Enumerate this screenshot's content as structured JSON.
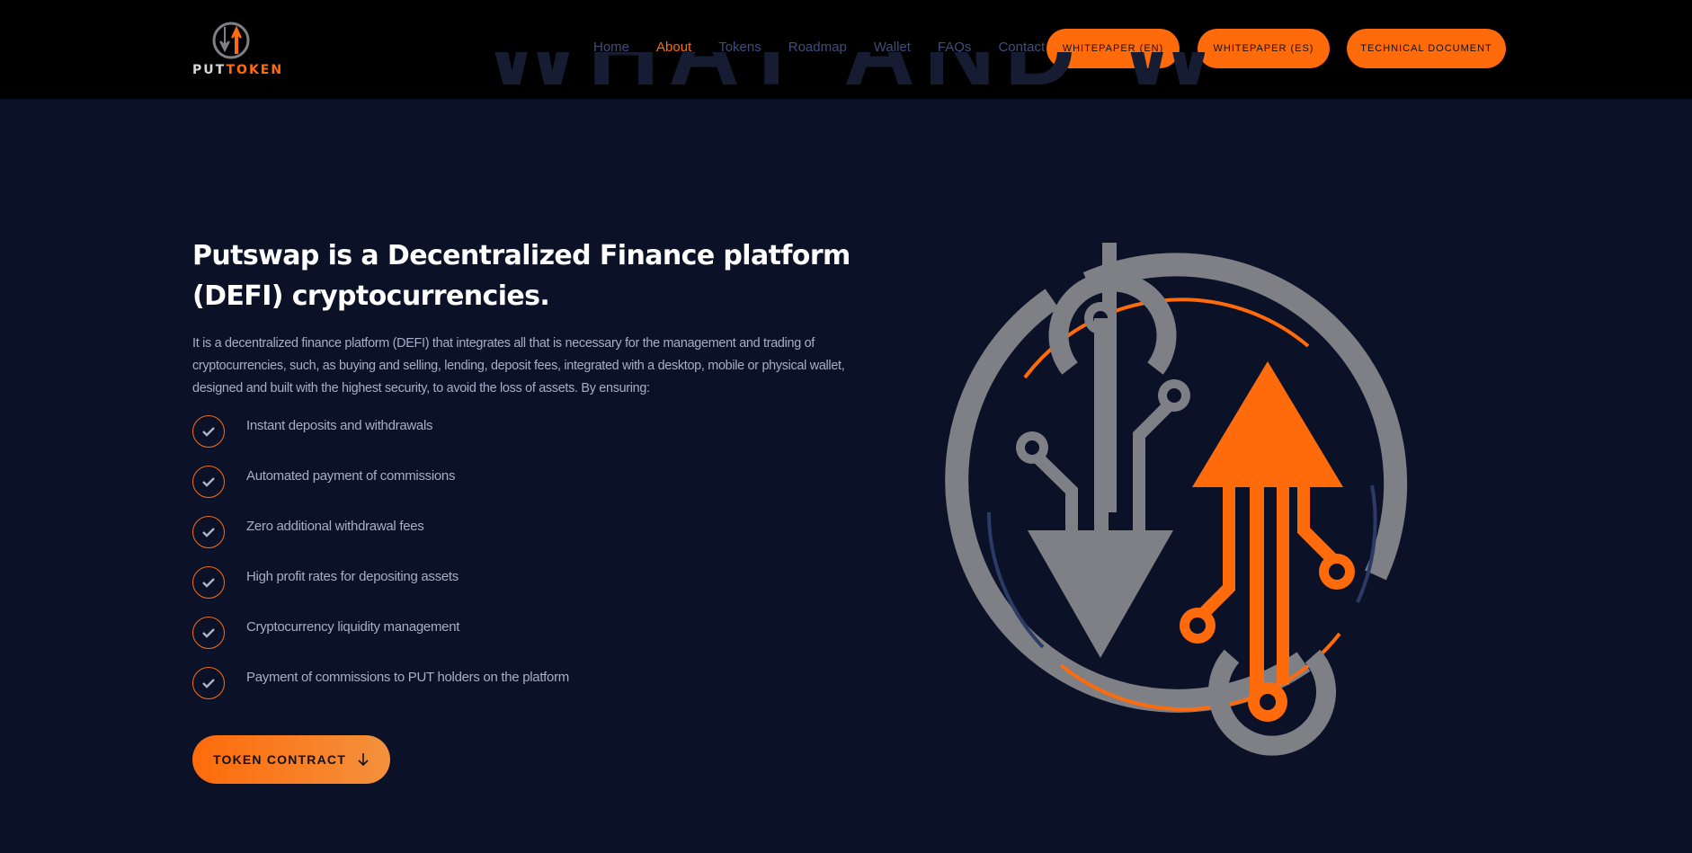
{
  "header": {
    "logo": {
      "put": "PUT",
      "token": "TOKEN"
    },
    "nav": [
      {
        "label": "Home",
        "active": false
      },
      {
        "label": "About",
        "active": true
      },
      {
        "label": "Tokens",
        "active": false
      },
      {
        "label": "Roadmap",
        "active": false
      },
      {
        "label": "Wallet",
        "active": false
      },
      {
        "label": "FAQs",
        "active": false
      },
      {
        "label": "Contact",
        "active": false
      }
    ],
    "buttons": {
      "whitepaper_en": "WHITEPAPER (EN)",
      "whitepaper_es": "WHITEPAPER (ES)",
      "technical_document": "TECHNICAL DOCUMENT"
    }
  },
  "section": {
    "ghost_title": "WHAT AND WHY",
    "title": "Putswap is a Decentralized Finance platform (DEFI) cryptocurrencies.",
    "description": "It is a decentralized finance platform (DEFI) that integrates all that is necessary for the management and trading of cryptocurrencies, such, as buying and selling, lending, deposit fees, integrated with a desktop, mobile or physical wallet, designed and built with the highest security, to avoid the loss of assets. By ensuring:",
    "features": [
      "Instant deposits and withdrawals",
      "Automated payment of commissions",
      "Zero additional withdrawal fees",
      "High profit rates for depositing assets",
      "Cryptocurrency liquidity management",
      "Payment of commissions to PUT holders on the platform"
    ],
    "cta": "TOKEN CONTRACT"
  },
  "colors": {
    "accent": "#ff6b0b",
    "background": "#0b1126",
    "header": "#000000",
    "nav_text": "#3f4d7c",
    "logo_gray": "#7f8085"
  },
  "icons": {
    "feature_check": "check-circle-icon",
    "cta_arrow": "arrow-down-icon",
    "hero": "puttoken-logo-illustration"
  }
}
